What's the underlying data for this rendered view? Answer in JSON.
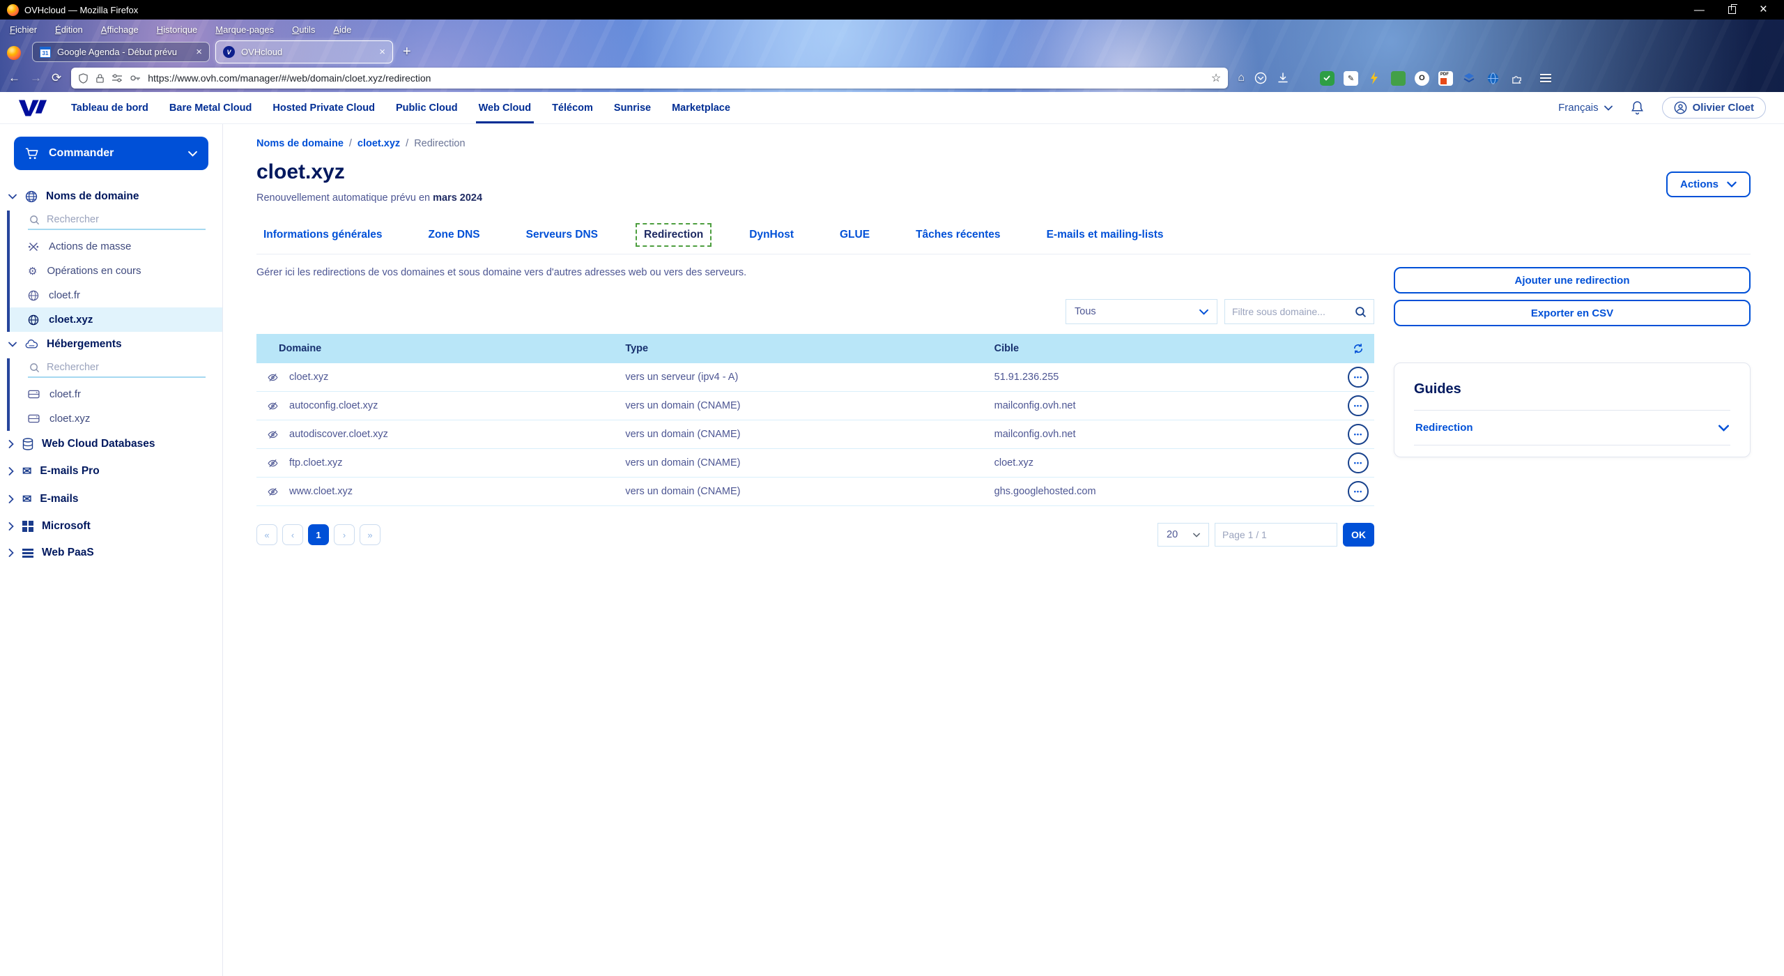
{
  "window": {
    "title": "OVHcloud — Mozilla Firefox",
    "minimize": "—",
    "close": "×"
  },
  "menu": {
    "items": [
      "Fichier",
      "Édition",
      "Affichage",
      "Historique",
      "Marque-pages",
      "Outils",
      "Aide"
    ]
  },
  "browser_tabs": {
    "tab1": {
      "favicon_text": "31",
      "title": "Google Agenda - Début prévu",
      "close": "×"
    },
    "tab2": {
      "favicon_text": "V",
      "title": "OVHcloud",
      "close": "×"
    },
    "new_tab": "+"
  },
  "toolbar": {
    "url": "https://www.ovh.com/manager/#/web/domain/cloet.xyz/redirection",
    "pdf_badge": "PDF",
    "opera_badge": "O"
  },
  "ovh_nav": {
    "items": [
      "Tableau de bord",
      "Bare Metal Cloud",
      "Hosted Private Cloud",
      "Public Cloud",
      "Web Cloud",
      "Télécom",
      "Sunrise",
      "Marketplace"
    ],
    "active": "Web Cloud",
    "language": "Français",
    "user": "Olivier Cloet"
  },
  "sidebar": {
    "order_label": "Commander",
    "domains_section": {
      "label": "Noms de domaine",
      "search_placeholder": "Rechercher",
      "items": [
        "Actions de masse",
        "Opérations en cours",
        "cloet.fr",
        "cloet.xyz"
      ],
      "active_item": "cloet.xyz"
    },
    "hosting_section": {
      "label": "Hébergements",
      "search_placeholder": "Rechercher",
      "items": [
        "cloet.fr",
        "cloet.xyz"
      ]
    },
    "collapsed_sections": [
      "Web Cloud Databases",
      "E-mails Pro",
      "E-mails",
      "Microsoft",
      "Web PaaS"
    ]
  },
  "breadcrumb": {
    "link1": "Noms de domaine",
    "sep": "/",
    "link2": "cloet.xyz",
    "current": "Redirection"
  },
  "page": {
    "title": "cloet.xyz",
    "renewal_prefix": "Renouvellement automatique prévu en ",
    "renewal_date": "mars 2024",
    "actions_label": "Actions"
  },
  "page_tabs": {
    "items": [
      "Informations générales",
      "Zone DNS",
      "Serveurs DNS",
      "Redirection",
      "DynHost",
      "GLUE",
      "Tâches récentes",
      "E-mails et mailing-lists"
    ],
    "active": "Redirection"
  },
  "redirections": {
    "description": "Gérer ici les redirections de vos domaines et sous domaine vers d'autres adresses web ou vers des serveurs.",
    "type_filter_value": "Tous",
    "subdomain_filter_placeholder": "Filtre sous domaine...",
    "table": {
      "headers": {
        "domain": "Domaine",
        "type": "Type",
        "target": "Cible"
      },
      "rows": [
        {
          "domain": "cloet.xyz",
          "type": "vers un serveur (ipv4 - A)",
          "target": "51.91.236.255"
        },
        {
          "domain": "autoconfig.cloet.xyz",
          "type": "vers un domain (CNAME)",
          "target": "mailconfig.ovh.net"
        },
        {
          "domain": "autodiscover.cloet.xyz",
          "type": "vers un domain (CNAME)",
          "target": "mailconfig.ovh.net"
        },
        {
          "domain": "ftp.cloet.xyz",
          "type": "vers un domain (CNAME)",
          "target": "cloet.xyz"
        },
        {
          "domain": "www.cloet.xyz",
          "type": "vers un domain (CNAME)",
          "target": "ghs.googlehosted.com"
        }
      ]
    },
    "pagination": {
      "first": "«",
      "prev": "‹",
      "page": "1",
      "next": "›",
      "last": "»",
      "page_size": "20",
      "page_indicator": "Page 1 / 1",
      "ok_label": "OK"
    },
    "add_button": "Ajouter une redirection",
    "export_button": "Exporter en CSV",
    "guides": {
      "title": "Guides",
      "link": "Redirection"
    }
  },
  "colors": {
    "primary": "#0050d7",
    "heading": "#00185e",
    "table_header_bg": "#b9e6f8",
    "focus_green": "#4d9e3f"
  }
}
